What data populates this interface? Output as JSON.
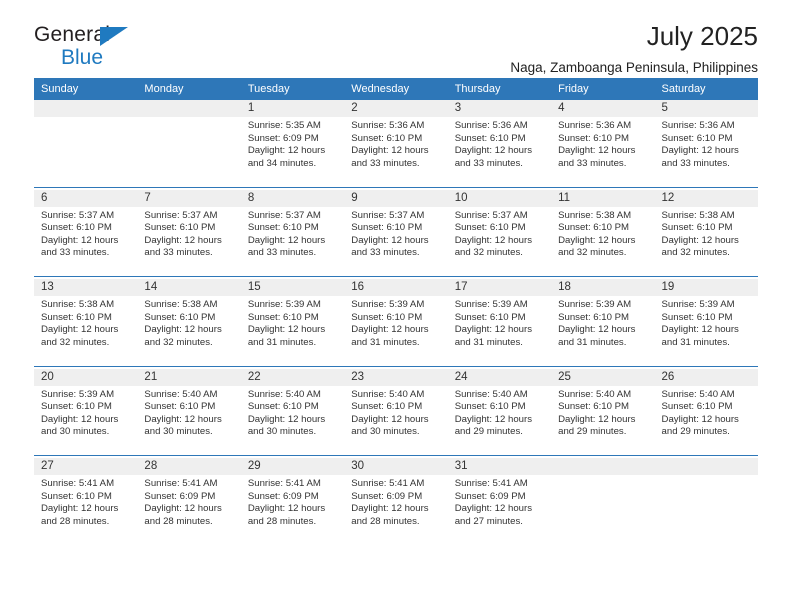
{
  "brand": {
    "name_part1": "General",
    "name_part2": "Blue",
    "triangle_color": "#1f7ac0"
  },
  "header": {
    "title": "July 2025",
    "subtitle": "Naga, Zamboanga Peninsula, Philippines"
  },
  "theme": {
    "header_blue": "#2e77b8",
    "daynum_gray": "#efefef",
    "text_dark": "#333333"
  },
  "calendar": {
    "weekday_headers": [
      "Sunday",
      "Monday",
      "Tuesday",
      "Wednesday",
      "Thursday",
      "Friday",
      "Saturday"
    ],
    "weeks": [
      [
        {
          "day": "",
          "lines": []
        },
        {
          "day": "",
          "lines": []
        },
        {
          "day": "1",
          "lines": [
            "Sunrise: 5:35 AM",
            "Sunset: 6:09 PM",
            "Daylight: 12 hours",
            "and 34 minutes."
          ]
        },
        {
          "day": "2",
          "lines": [
            "Sunrise: 5:36 AM",
            "Sunset: 6:10 PM",
            "Daylight: 12 hours",
            "and 33 minutes."
          ]
        },
        {
          "day": "3",
          "lines": [
            "Sunrise: 5:36 AM",
            "Sunset: 6:10 PM",
            "Daylight: 12 hours",
            "and 33 minutes."
          ]
        },
        {
          "day": "4",
          "lines": [
            "Sunrise: 5:36 AM",
            "Sunset: 6:10 PM",
            "Daylight: 12 hours",
            "and 33 minutes."
          ]
        },
        {
          "day": "5",
          "lines": [
            "Sunrise: 5:36 AM",
            "Sunset: 6:10 PM",
            "Daylight: 12 hours",
            "and 33 minutes."
          ]
        }
      ],
      [
        {
          "day": "6",
          "lines": [
            "Sunrise: 5:37 AM",
            "Sunset: 6:10 PM",
            "Daylight: 12 hours",
            "and 33 minutes."
          ]
        },
        {
          "day": "7",
          "lines": [
            "Sunrise: 5:37 AM",
            "Sunset: 6:10 PM",
            "Daylight: 12 hours",
            "and 33 minutes."
          ]
        },
        {
          "day": "8",
          "lines": [
            "Sunrise: 5:37 AM",
            "Sunset: 6:10 PM",
            "Daylight: 12 hours",
            "and 33 minutes."
          ]
        },
        {
          "day": "9",
          "lines": [
            "Sunrise: 5:37 AM",
            "Sunset: 6:10 PM",
            "Daylight: 12 hours",
            "and 33 minutes."
          ]
        },
        {
          "day": "10",
          "lines": [
            "Sunrise: 5:37 AM",
            "Sunset: 6:10 PM",
            "Daylight: 12 hours",
            "and 32 minutes."
          ]
        },
        {
          "day": "11",
          "lines": [
            "Sunrise: 5:38 AM",
            "Sunset: 6:10 PM",
            "Daylight: 12 hours",
            "and 32 minutes."
          ]
        },
        {
          "day": "12",
          "lines": [
            "Sunrise: 5:38 AM",
            "Sunset: 6:10 PM",
            "Daylight: 12 hours",
            "and 32 minutes."
          ]
        }
      ],
      [
        {
          "day": "13",
          "lines": [
            "Sunrise: 5:38 AM",
            "Sunset: 6:10 PM",
            "Daylight: 12 hours",
            "and 32 minutes."
          ]
        },
        {
          "day": "14",
          "lines": [
            "Sunrise: 5:38 AM",
            "Sunset: 6:10 PM",
            "Daylight: 12 hours",
            "and 32 minutes."
          ]
        },
        {
          "day": "15",
          "lines": [
            "Sunrise: 5:39 AM",
            "Sunset: 6:10 PM",
            "Daylight: 12 hours",
            "and 31 minutes."
          ]
        },
        {
          "day": "16",
          "lines": [
            "Sunrise: 5:39 AM",
            "Sunset: 6:10 PM",
            "Daylight: 12 hours",
            "and 31 minutes."
          ]
        },
        {
          "day": "17",
          "lines": [
            "Sunrise: 5:39 AM",
            "Sunset: 6:10 PM",
            "Daylight: 12 hours",
            "and 31 minutes."
          ]
        },
        {
          "day": "18",
          "lines": [
            "Sunrise: 5:39 AM",
            "Sunset: 6:10 PM",
            "Daylight: 12 hours",
            "and 31 minutes."
          ]
        },
        {
          "day": "19",
          "lines": [
            "Sunrise: 5:39 AM",
            "Sunset: 6:10 PM",
            "Daylight: 12 hours",
            "and 31 minutes."
          ]
        }
      ],
      [
        {
          "day": "20",
          "lines": [
            "Sunrise: 5:39 AM",
            "Sunset: 6:10 PM",
            "Daylight: 12 hours",
            "and 30 minutes."
          ]
        },
        {
          "day": "21",
          "lines": [
            "Sunrise: 5:40 AM",
            "Sunset: 6:10 PM",
            "Daylight: 12 hours",
            "and 30 minutes."
          ]
        },
        {
          "day": "22",
          "lines": [
            "Sunrise: 5:40 AM",
            "Sunset: 6:10 PM",
            "Daylight: 12 hours",
            "and 30 minutes."
          ]
        },
        {
          "day": "23",
          "lines": [
            "Sunrise: 5:40 AM",
            "Sunset: 6:10 PM",
            "Daylight: 12 hours",
            "and 30 minutes."
          ]
        },
        {
          "day": "24",
          "lines": [
            "Sunrise: 5:40 AM",
            "Sunset: 6:10 PM",
            "Daylight: 12 hours",
            "and 29 minutes."
          ]
        },
        {
          "day": "25",
          "lines": [
            "Sunrise: 5:40 AM",
            "Sunset: 6:10 PM",
            "Daylight: 12 hours",
            "and 29 minutes."
          ]
        },
        {
          "day": "26",
          "lines": [
            "Sunrise: 5:40 AM",
            "Sunset: 6:10 PM",
            "Daylight: 12 hours",
            "and 29 minutes."
          ]
        }
      ],
      [
        {
          "day": "27",
          "lines": [
            "Sunrise: 5:41 AM",
            "Sunset: 6:10 PM",
            "Daylight: 12 hours",
            "and 28 minutes."
          ]
        },
        {
          "day": "28",
          "lines": [
            "Sunrise: 5:41 AM",
            "Sunset: 6:09 PM",
            "Daylight: 12 hours",
            "and 28 minutes."
          ]
        },
        {
          "day": "29",
          "lines": [
            "Sunrise: 5:41 AM",
            "Sunset: 6:09 PM",
            "Daylight: 12 hours",
            "and 28 minutes."
          ]
        },
        {
          "day": "30",
          "lines": [
            "Sunrise: 5:41 AM",
            "Sunset: 6:09 PM",
            "Daylight: 12 hours",
            "and 28 minutes."
          ]
        },
        {
          "day": "31",
          "lines": [
            "Sunrise: 5:41 AM",
            "Sunset: 6:09 PM",
            "Daylight: 12 hours",
            "and 27 minutes."
          ]
        },
        {
          "day": "",
          "lines": []
        },
        {
          "day": "",
          "lines": []
        }
      ]
    ]
  }
}
